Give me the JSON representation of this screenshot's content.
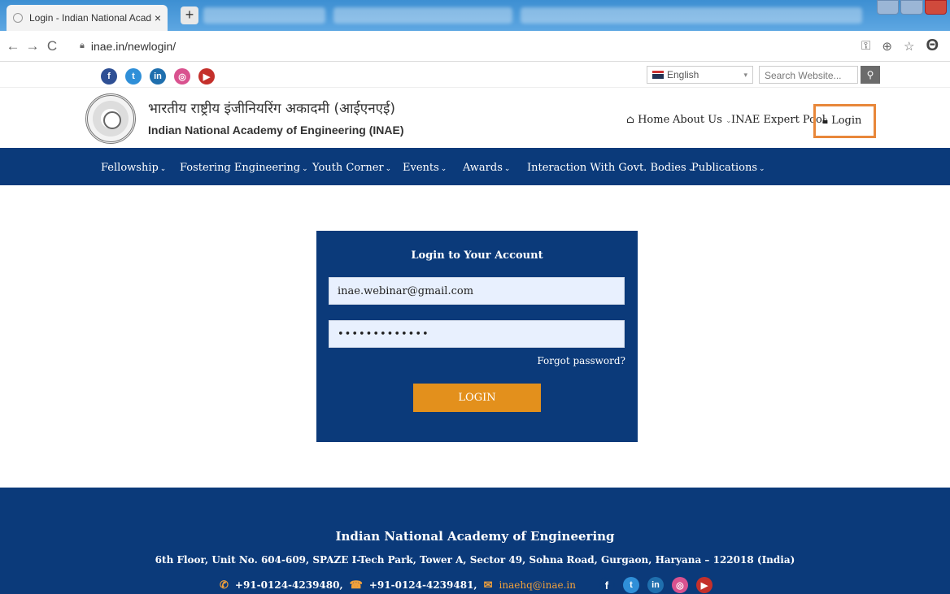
{
  "browser": {
    "tab_title": "Login - Indian National Academy",
    "tab_close": "×",
    "new_tab": "+",
    "url": "inae.in/newlogin/",
    "nav_back": "←",
    "nav_forward": "→",
    "nav_reload": "C",
    "icons": {
      "key": "key-icon",
      "zoom": "zoom-icon",
      "star": "star-icon",
      "profile": "profile-icon"
    }
  },
  "header": {
    "social": [
      {
        "name": "facebook",
        "glyph": "f"
      },
      {
        "name": "twitter",
        "glyph": "t"
      },
      {
        "name": "linkedin",
        "glyph": "in"
      },
      {
        "name": "instagram",
        "glyph": "◎"
      },
      {
        "name": "youtube",
        "glyph": "▶"
      }
    ],
    "language": "English",
    "search_placeholder": "Search Website...",
    "site_name_hindi": "भारतीय राष्ट्रीय इंजीनियरिंग अकादमी (आईएनएई)",
    "site_name": "Indian National Academy of Engineering (INAE)",
    "topnav": {
      "home": "Home",
      "about": "About Us",
      "expert_pool": "INAE Expert Pool",
      "login": "Login"
    }
  },
  "mainnav": [
    {
      "label": "Fellowship"
    },
    {
      "label": "Fostering Engineering"
    },
    {
      "label": "Youth Corner"
    },
    {
      "label": "Events"
    },
    {
      "label": "Awards"
    },
    {
      "label": "Interaction With Govt. Bodies"
    },
    {
      "label": "Publications"
    }
  ],
  "login": {
    "title": "Login to Your Account",
    "email_value": "inae.webinar@gmail.com",
    "password_value": "•••••••••••••",
    "forgot": "Forgot password?",
    "button": "LOGIN"
  },
  "footer": {
    "title": "Indian National Academy of Engineering",
    "address": "6th Floor, Unit No. 604-609, SPAZE I-Tech Park, Tower A, Sector 49, Sohna Road, Gurgaon, Haryana – 122018 (India)",
    "phone": "+91-0124-4239480,",
    "fax": "+91-0124-4239481,",
    "email": "inaehq@inae.in"
  },
  "colors": {
    "navy": "#0b3a7a",
    "orange": "#e3901c",
    "highlight": "#e8873a"
  }
}
